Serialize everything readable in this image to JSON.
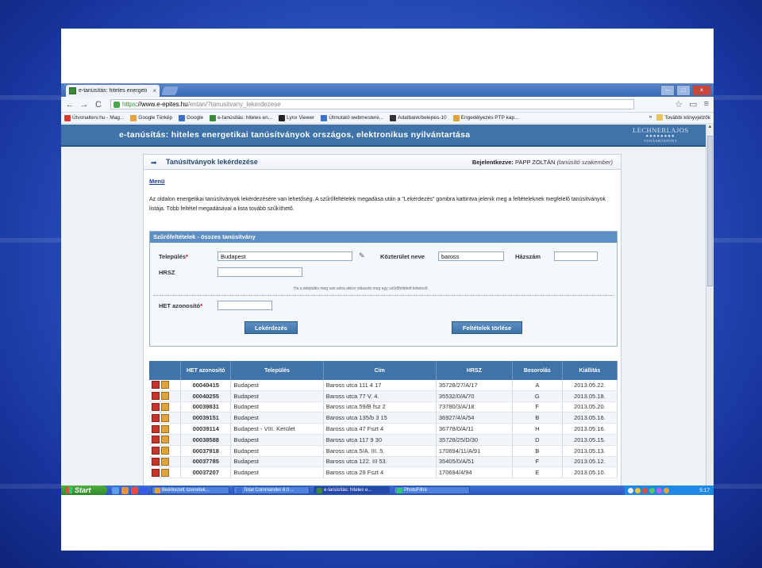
{
  "browser": {
    "tab_title": "e-tanúsítás: hiteles energeti",
    "tab_close": "×",
    "url_https": "https",
    "url_domain": "://www.e-epites.hu",
    "url_path": "/entan/?tanusitvany_lekerdezese",
    "back": "←",
    "forward": "→",
    "reload": "C",
    "bookmarks": [
      {
        "label": "Útvonalterv.hu - Mag...",
        "color": "#d93a2b"
      },
      {
        "label": "Google Térkép",
        "color": "#e8a33c"
      },
      {
        "label": "Google",
        "color": "#3b6fd1"
      },
      {
        "label": "e-tanúsítás: hiteles en...",
        "color": "#3b8a3a"
      },
      {
        "label": "Lynx Viewer",
        "color": "#222222"
      },
      {
        "label": "Útmutató webmestere...",
        "color": "#3b6fd1"
      },
      {
        "label": "Adatbank/belepes-10",
        "color": "#333333"
      },
      {
        "label": "Engedélyezés PTP kap...",
        "color": "#e0a33a"
      }
    ],
    "bookmarks_more": "»",
    "other_bookmarks": "További könyvjelzők"
  },
  "site": {
    "header_title": "e-tanúsítás: hiteles energetikai tanúsítványok országos, elektronikus nyilvántartása",
    "logo_main": "LECHNERLAJOS",
    "logo_dots": "●●●●●●●●",
    "logo_sub": "TUDÁSKÖZPONT",
    "page_title": "Tanúsítványok lekérdezése",
    "login_label": "Bejelentkezve:",
    "login_name": "PAPP ZOLTÁN",
    "login_role": "(tanúsító szakember)",
    "menu": "Menü",
    "intro": "Az oldalon energetikai tanúsítványok lekérdezésére van lehetőség. A szűrőfeltételek megadása után a \"Lekérdezés\" gombra kattintva jelenik meg a feltételeknek megfelelő tanúsítványok listája. Több feltétel megadásával a lista tovább szűkíthető."
  },
  "filter": {
    "title": "Szűrőfeltételek - összes tanúsítvány",
    "telepules_label": "Település",
    "telepules_value": "Budapest",
    "kozterulet_label": "Közterület neve",
    "kozterulet_value": "baross",
    "hazszam_label": "Házszám",
    "hazszam_value": "",
    "hrsz_label": "HRSZ",
    "hrsz_value": "",
    "hint": "Ha a település meg van adva akkor választó meg egy szűrőfeltételt kötelező.",
    "het_label": "HET azonosító",
    "het_value": "",
    "query_button": "Lekérdezés",
    "clear_button": "Feltételek törlése",
    "required_mark": "*"
  },
  "table": {
    "headers": [
      "",
      "HET azonosító",
      "Település",
      "Cím",
      "HRSZ",
      "Besorolás",
      "Kiállítás"
    ],
    "rows": [
      {
        "het": "00040415",
        "telepules": "Budapest",
        "cim": "Baross utca 111 4 17",
        "hrsz": "35728/27/A/17",
        "besorolas": "A",
        "kiallitas": "2013.05.22."
      },
      {
        "het": "00040255",
        "telepules": "Budapest",
        "cim": "Baross utca 77 V. 4.",
        "hrsz": "35532/0/A/70",
        "besorolas": "G",
        "kiallitas": "2013.05.18."
      },
      {
        "het": "00039831",
        "telepules": "Budapest",
        "cim": "Baross utca 59/B fsz 2",
        "hrsz": "73780/3/A/18",
        "besorolas": "F",
        "kiallitas": "2013.05.20."
      },
      {
        "het": "00039151",
        "telepules": "Budapest",
        "cim": "Baross utca 135/b 3 15",
        "hrsz": "36927/4/A/54",
        "besorolas": "B",
        "kiallitas": "2013.05.16."
      },
      {
        "het": "00039114",
        "telepules": "Budapest - VIII. Kerület",
        "cim": "Baross utca 47 Fszt 4",
        "hrsz": "36778/0/A/11",
        "besorolas": "H",
        "kiallitas": "2013.05.16."
      },
      {
        "het": "00038588",
        "telepules": "Budapest",
        "cim": "Baross utca 117 9 30",
        "hrsz": "35728/25/D/30",
        "besorolas": "D",
        "kiallitas": "2013.05.15."
      },
      {
        "het": "00037918",
        "telepules": "Budapest",
        "cim": "Baross utca 5/A. III. 5.",
        "hrsz": "170694/11/A/91",
        "besorolas": "B",
        "kiallitas": "2013.05.13."
      },
      {
        "het": "00037785",
        "telepules": "Budapest",
        "cim": "Baross utca 122. III 53.",
        "hrsz": "35405/0/A/51",
        "besorolas": "F",
        "kiallitas": "2013.05.12."
      },
      {
        "het": "00037207",
        "telepules": "Budapest",
        "cim": "Baross utca 29 Fszt 4",
        "hrsz": "170694/4/94",
        "besorolas": "E",
        "kiallitas": "2013.05.10."
      }
    ]
  },
  "taskbar": {
    "start": "Start",
    "tasks": [
      {
        "label": "Beérkezett üzenetek...",
        "color": "#e0a33a",
        "active": false
      },
      {
        "label": "Total Commander 8.0...",
        "color": "#3b6fd1",
        "active": false
      },
      {
        "label": "e-tanúsítás: hiteles e...",
        "color": "#3b8a3a",
        "active": true
      },
      {
        "label": "PhotoFiltre",
        "color": "#2ecc71",
        "active": false
      }
    ],
    "clock": "5:17"
  }
}
